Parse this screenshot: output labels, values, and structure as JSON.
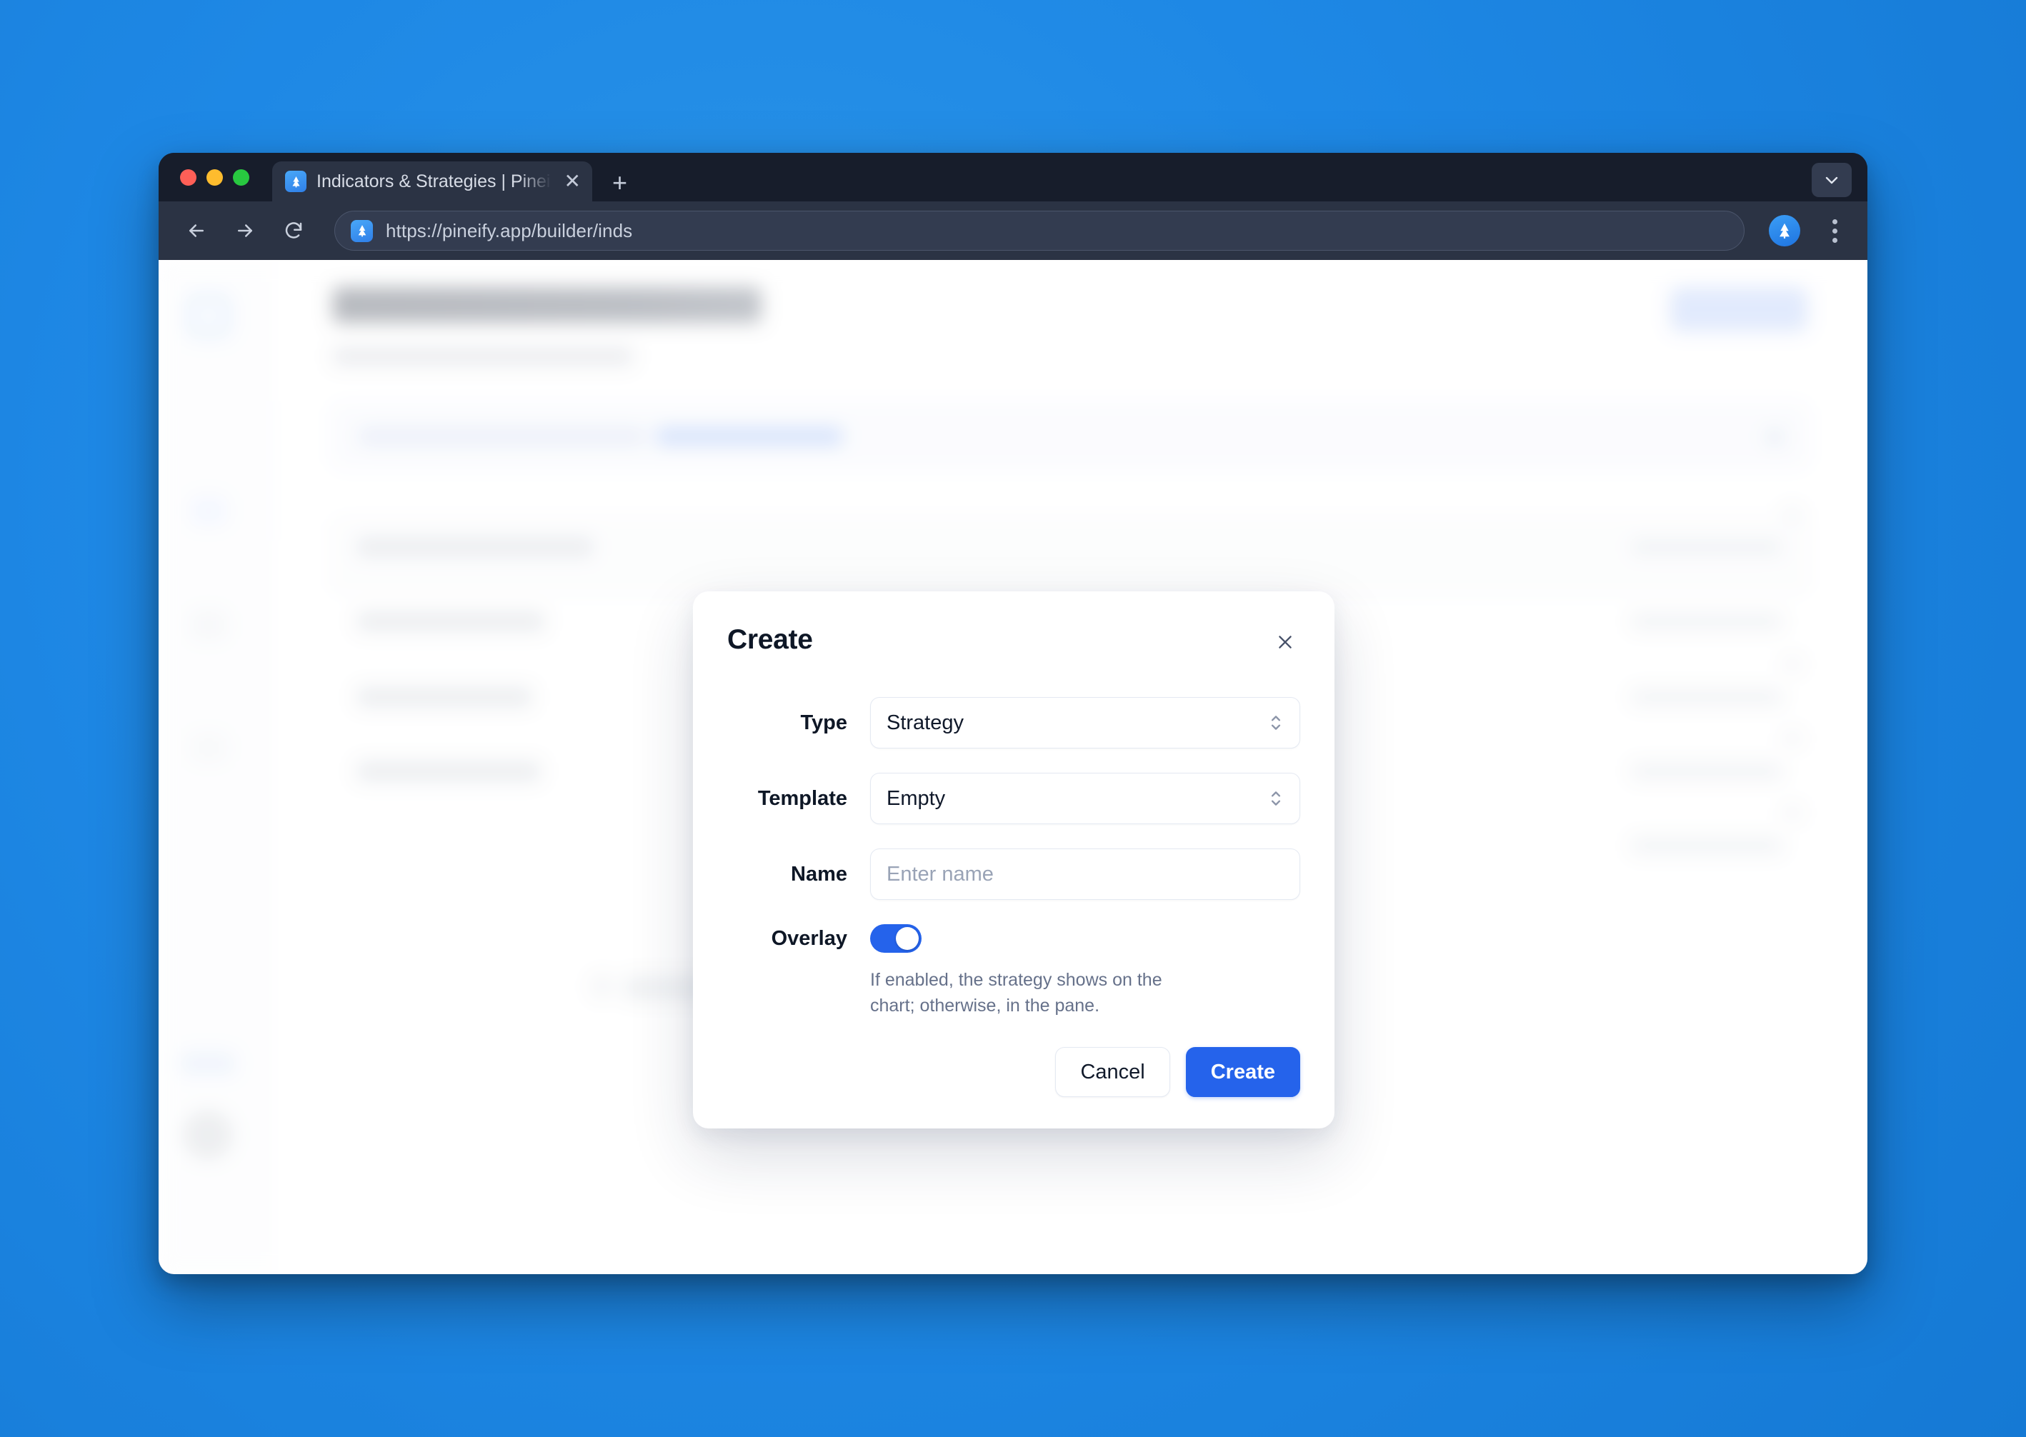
{
  "browser": {
    "tab": {
      "title": "Indicators & Strategies | Pinei",
      "favicon_icon": "pine-tree-icon",
      "close_icon": "close-icon"
    },
    "new_tab_label": "+",
    "tab_list_icon": "chevron-down-icon",
    "toolbar": {
      "back_icon": "arrow-left-icon",
      "forward_icon": "arrow-right-icon",
      "reload_icon": "reload-icon",
      "url": "https://pineify.app/builder/inds",
      "site_icon": "pine-tree-icon",
      "extension_icon": "pine-tree-icon",
      "menu_icon": "kebab-menu-icon"
    }
  },
  "modal": {
    "title": "Create",
    "close_icon": "close-icon",
    "fields": {
      "type": {
        "label": "Type",
        "value": "Strategy",
        "chevron_icon": "chevron-up-down-icon"
      },
      "template": {
        "label": "Template",
        "value": "Empty",
        "chevron_icon": "chevron-up-down-icon"
      },
      "name": {
        "label": "Name",
        "value": "",
        "placeholder": "Enter name"
      },
      "overlay": {
        "label": "Overlay",
        "enabled": true,
        "hint": "If enabled, the strategy shows on the chart; otherwise, in the pane."
      }
    },
    "actions": {
      "cancel_label": "Cancel",
      "create_label": "Create"
    }
  },
  "colors": {
    "desktop_background": "#1e88e5",
    "browser_chrome": "#2b3344",
    "tab_strip": "#171d2b",
    "accent_blue": "#2563eb",
    "toggle_on": "#2563eb",
    "text_primary": "#0e1726",
    "text_muted": "#66718a",
    "placeholder": "#99a3b6",
    "field_border": "#e4e9f2"
  }
}
